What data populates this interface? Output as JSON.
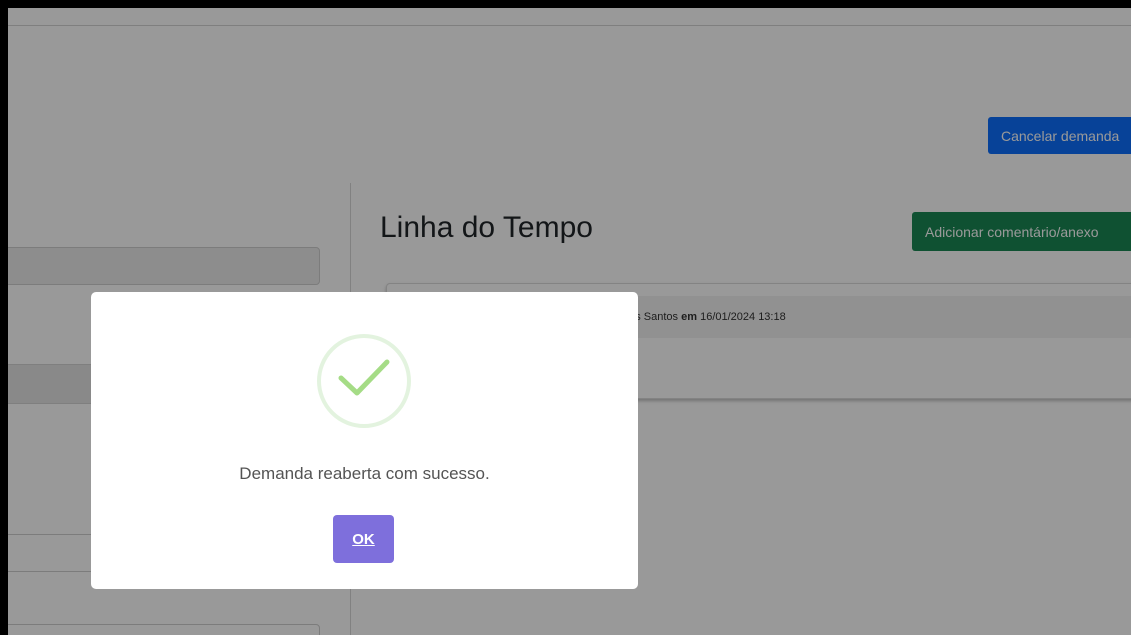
{
  "header": {
    "cancel_button_label": "Cancelar demanda"
  },
  "timeline": {
    "title": "Linha do Tempo",
    "add_comment_label": "Adicionar comentário/anexo",
    "entries": [
      {
        "author_fragment": "dos Santos",
        "connector": "em",
        "timestamp": "16/01/2024 13:18"
      }
    ]
  },
  "dialog": {
    "icon": "checkmark-success-icon",
    "message": "Demanda reaberta com sucesso.",
    "ok_label": "OK"
  },
  "colors": {
    "primary": "#0d6efd",
    "success": "#198754",
    "dialog_confirm": "#7e6fdc",
    "check_green": "#a5dc86",
    "overlay": "rgba(0,0,0,0.4)"
  }
}
